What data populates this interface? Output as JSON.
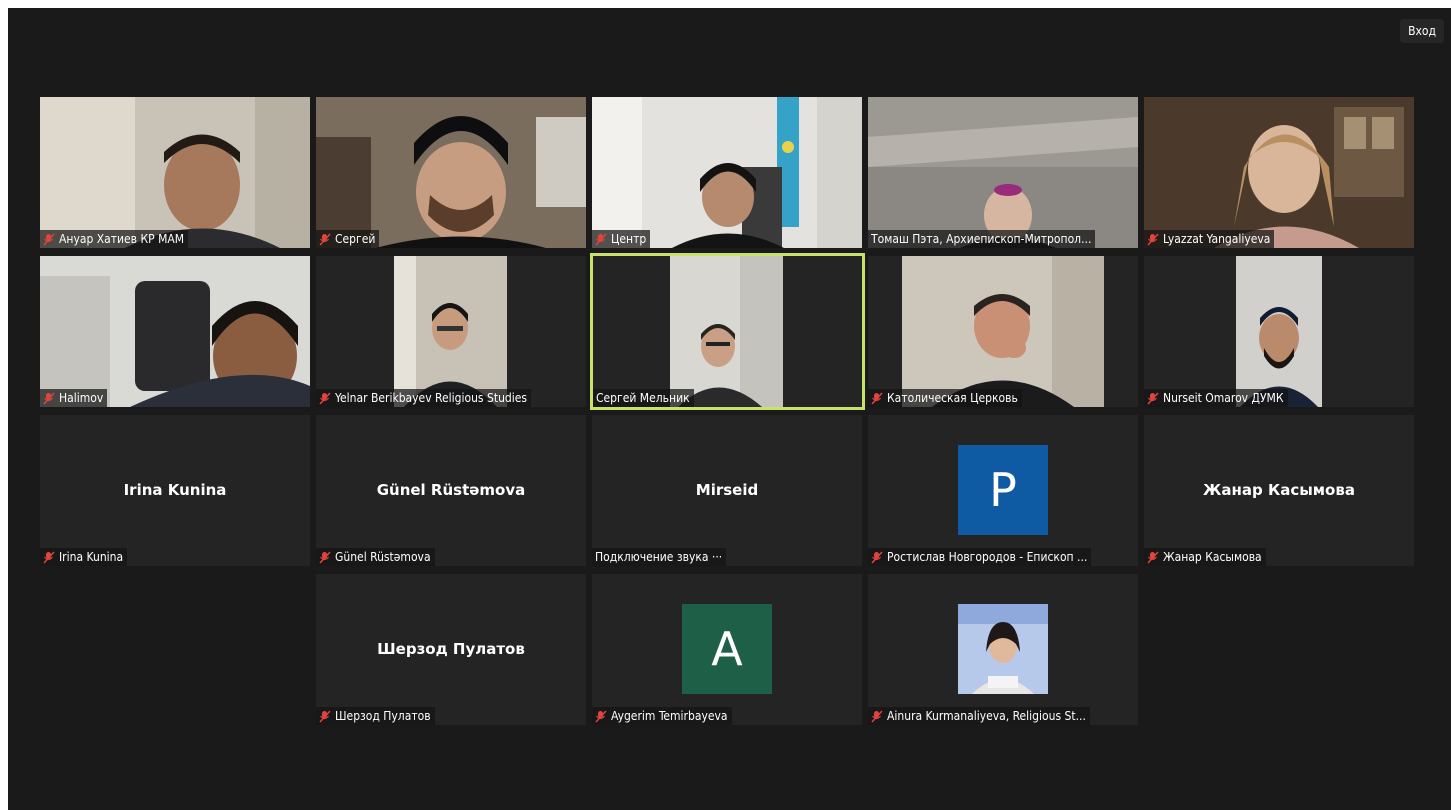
{
  "header": {
    "enter_label": "Вход"
  },
  "colors": {
    "background": "#1a1a1a",
    "tile": "#242424",
    "active_border": "#c7e26a",
    "mic_muted": "#e0443a"
  },
  "participants": [
    {
      "label": "Ануар Хатиев КР МАМ",
      "muted": true,
      "video": true
    },
    {
      "label": "Сергей",
      "muted": true,
      "video": true
    },
    {
      "label": "Центр",
      "muted": true,
      "video": true
    },
    {
      "label": "Томаш Пэта, Архиепископ-Митропол...",
      "muted": false,
      "video": true
    },
    {
      "label": "Lyazzat Yangaliyeva",
      "muted": true,
      "video": true
    },
    {
      "label": "Halimov",
      "muted": true,
      "video": true
    },
    {
      "label": "Yelnar Berikbayev Religious Studies",
      "muted": true,
      "video": true
    },
    {
      "label": "Сергей Мельник",
      "muted": false,
      "video": true,
      "speaking": true
    },
    {
      "label": "Католическая Церковь",
      "muted": true,
      "video": true
    },
    {
      "label": "Nurseit Omarov ДУМК",
      "muted": true,
      "video": true
    },
    {
      "label": "Irina Kunina",
      "display_name": "Irina Kunina",
      "muted": true
    },
    {
      "label": "Günel Rüstəmova",
      "display_name": "Günel Rüstəmova",
      "muted": true
    },
    {
      "label": "Подключение звука ···",
      "display_name": "Mirseid",
      "muted": false
    },
    {
      "label": "Ростислав Новгородов - Епископ ...",
      "avatar_letter": "P",
      "avatar_color": "#0e5ba3",
      "muted": true
    },
    {
      "label": "Жанар Касымова",
      "display_name": "Жанар Касымова",
      "muted": true
    },
    {
      "label": "Шерзод Пулатов",
      "display_name": "Шерзод Пулатов",
      "muted": true
    },
    {
      "label": "Aygerim Temirbayeva",
      "avatar_letter": "A",
      "avatar_color": "#1e5f48",
      "muted": true
    },
    {
      "label": "Ainura Kurmanaliyeva, Religious St...",
      "avatar_photo": true,
      "muted": true
    }
  ]
}
